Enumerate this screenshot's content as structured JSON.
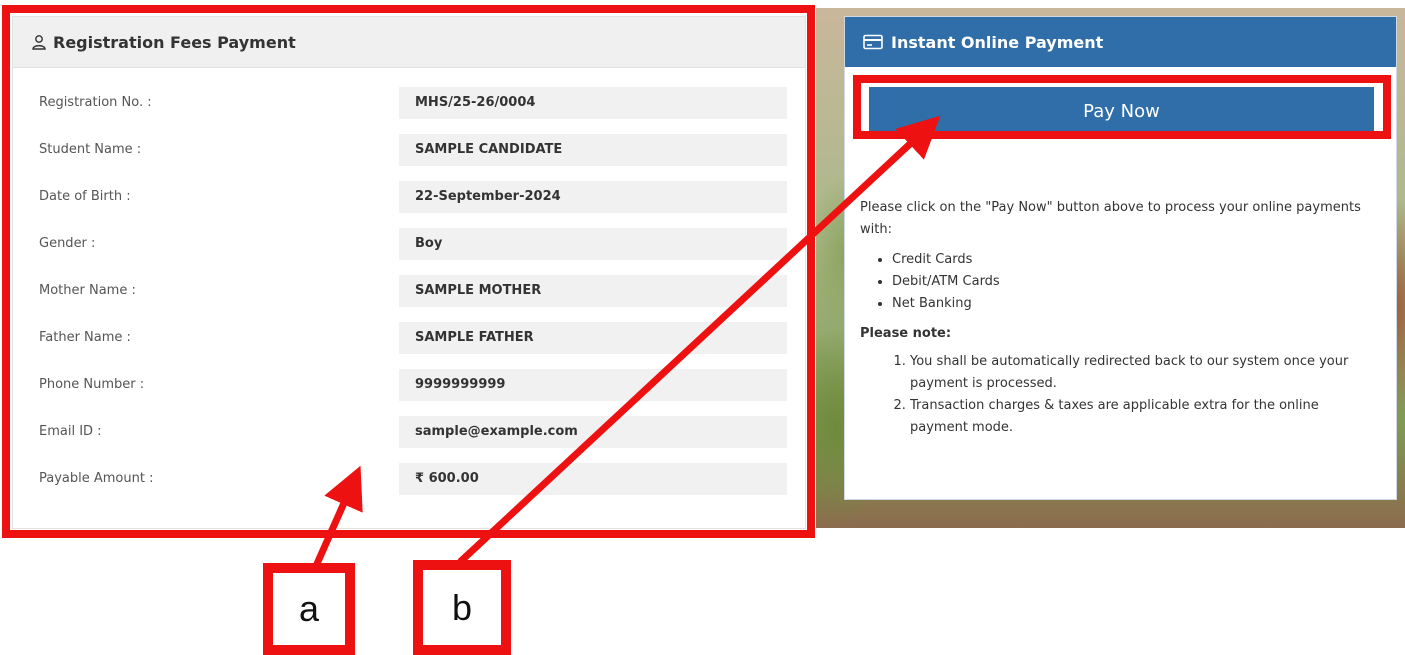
{
  "registration_panel": {
    "title": "Registration Fees Payment",
    "fields": [
      {
        "label": "Registration No. :",
        "value": "MHS/25-26/0004"
      },
      {
        "label": "Student Name :",
        "value": "SAMPLE CANDIDATE"
      },
      {
        "label": "Date of Birth :",
        "value": "22-September-2024"
      },
      {
        "label": "Gender :",
        "value": "Boy"
      },
      {
        "label": "Mother Name :",
        "value": "SAMPLE MOTHER"
      },
      {
        "label": "Father Name :",
        "value": "SAMPLE FATHER"
      },
      {
        "label": "Phone Number :",
        "value": "9999999999"
      },
      {
        "label": "Email ID :",
        "value": "sample@example.com"
      },
      {
        "label": "Payable Amount :",
        "value": "₹ 600.00"
      }
    ]
  },
  "payment_panel": {
    "title": "Instant Online Payment",
    "pay_button_label": "Pay Now",
    "intro": "Please click on the \"Pay Now\" button above to process your online payments with:",
    "methods": [
      "Credit Cards",
      "Debit/ATM Cards",
      "Net Banking"
    ],
    "note_title": "Please note:",
    "notes": [
      "You shall be automatically redirected back to our system once your payment is processed.",
      "Transaction charges & taxes are applicable extra for the online payment mode."
    ]
  },
  "annotations": {
    "label_a": "a",
    "label_b": "b",
    "color": "#ee1111"
  },
  "colors": {
    "header_blue": "#2f6ea8",
    "value_bg": "#f1f1f1"
  }
}
